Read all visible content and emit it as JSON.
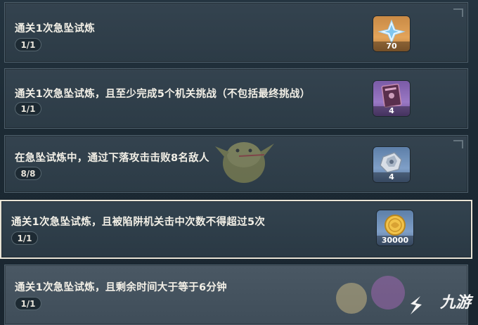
{
  "challenges": [
    {
      "title": "通关1次急坠试炼",
      "progress": "1/1",
      "reward": {
        "icon": "primogem-icon",
        "count": "70"
      }
    },
    {
      "title": "通关1次急坠试炼，且至少完成5个机关挑战（不包括最终挑战）",
      "progress": "1/1",
      "reward": {
        "icon": "book-icon",
        "count": "4"
      }
    },
    {
      "title": "在急坠试炼中，通过下落攻击击败8名敌人",
      "progress": "8/8",
      "reward": {
        "icon": "ore-icon",
        "count": "4"
      }
    },
    {
      "title": "通关1次急坠试炼，且被陷阱机关击中次数不得超过5次",
      "progress": "1/1",
      "reward": {
        "icon": "mora-icon",
        "count": "30000"
      }
    },
    {
      "title": "通关1次急坠试炼，且剩余时间大于等于6分钟",
      "progress": "1/1",
      "reward": {
        "icon": "blurred-reward-icon",
        "count": ""
      }
    }
  ],
  "brand": {
    "logo_text": "九游"
  },
  "colors": {
    "card_bg": "#2e3d48",
    "highlight_border": "#e9e4d6",
    "text": "#f2efe6"
  }
}
